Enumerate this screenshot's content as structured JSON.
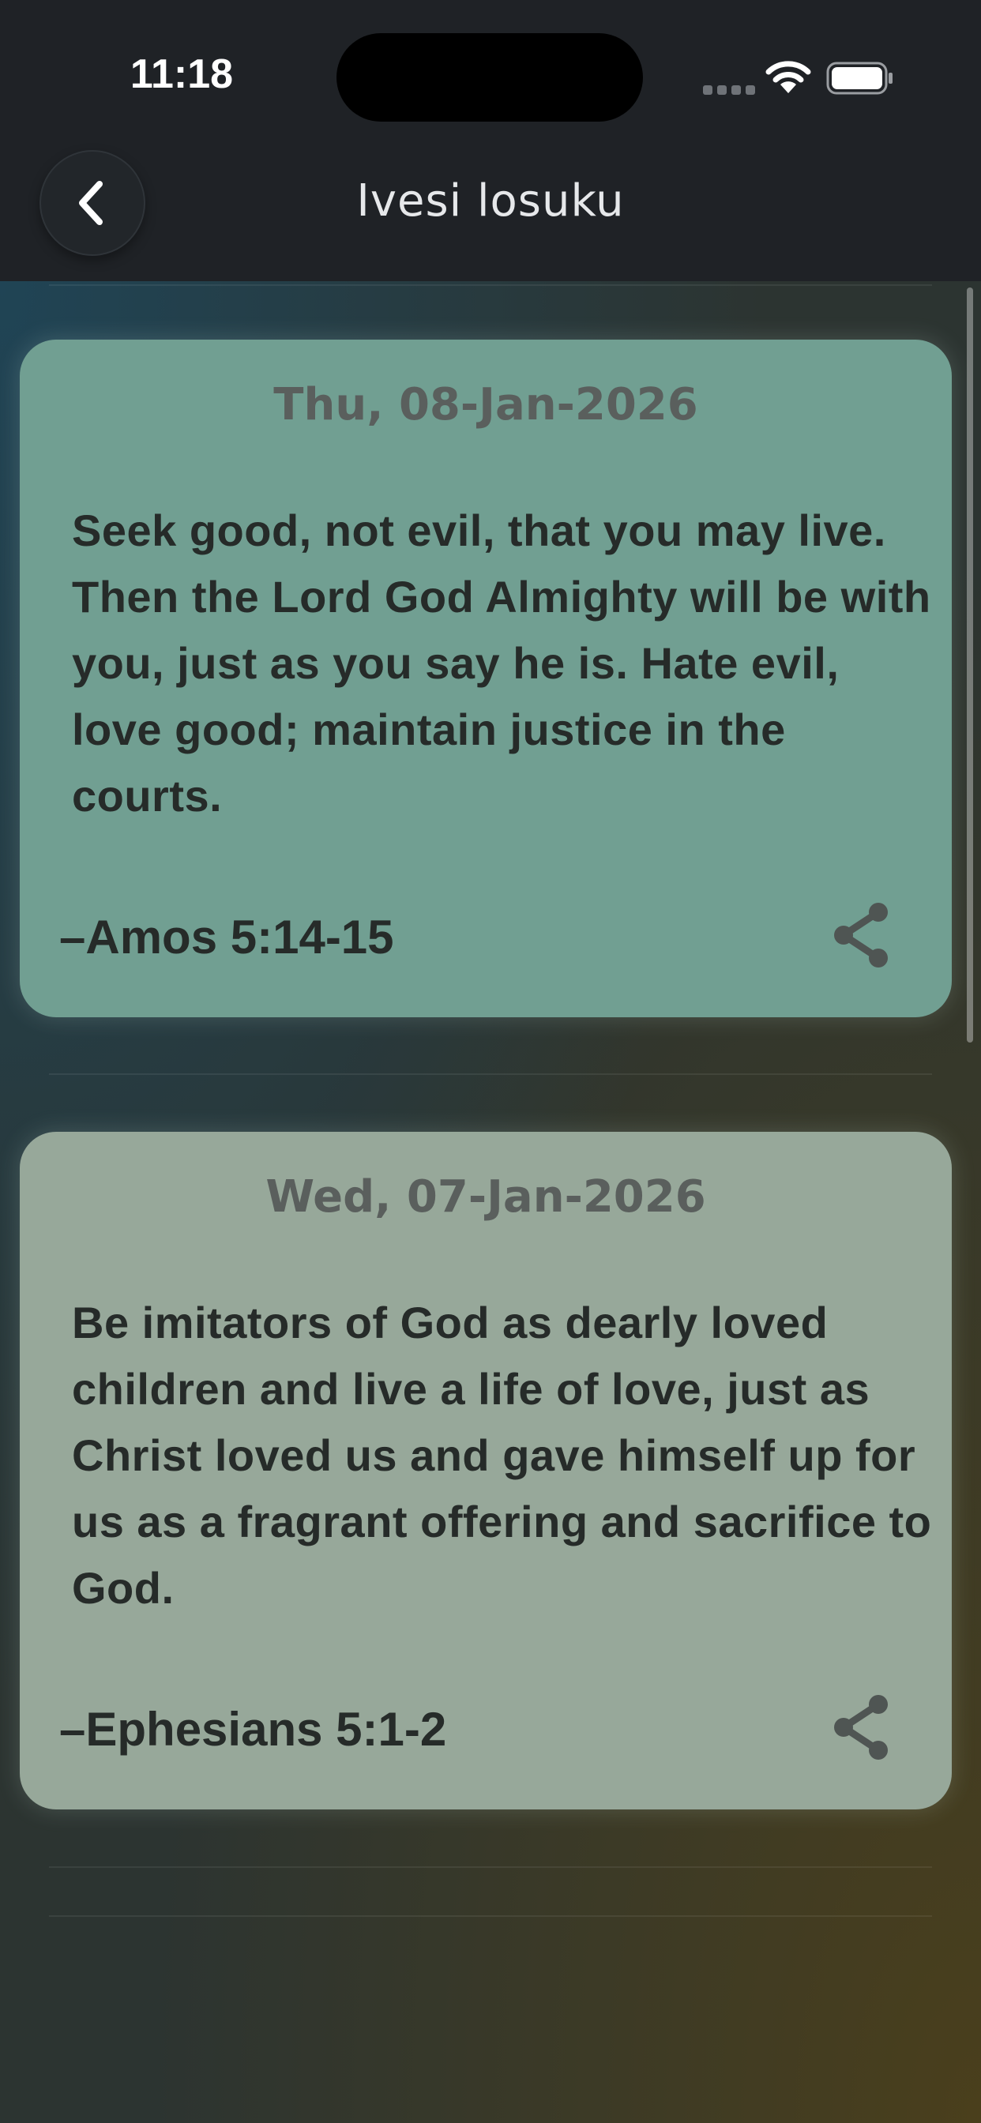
{
  "status_bar": {
    "time": "11:18"
  },
  "header": {
    "title": "Ivesi losuku",
    "back_icon": "chevron-left-icon"
  },
  "cards": [
    {
      "date": "Thu, 08-Jan-2026",
      "text": "Seek good, not evil, that you may live. Then the Lord God Almighty will be with you, just as you say he is. Hate evil, love good; maintain justice in the courts.",
      "reference": "–Amos 5:14-15",
      "background": "#719f92",
      "share_icon": "share-icon"
    },
    {
      "date": "Wed, 07-Jan-2026",
      "text": "Be imitators of God as dearly loved children and live a life of love, just as Christ loved us and gave himself up for us as a fragrant offering and sacrifice to God.",
      "reference": "–Ephesians 5:1-2",
      "background": "#97a89a",
      "share_icon": "share-icon"
    }
  ]
}
